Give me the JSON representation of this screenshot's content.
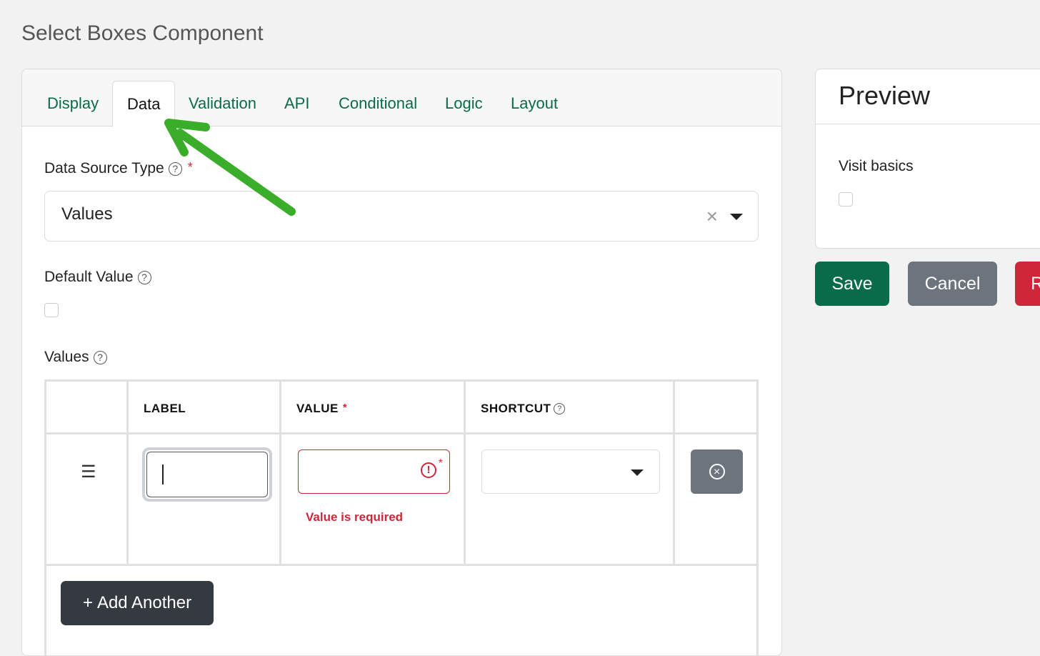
{
  "page": {
    "title": "Select Boxes Component"
  },
  "tabs": [
    {
      "label": "Display"
    },
    {
      "label": "Data"
    },
    {
      "label": "Validation"
    },
    {
      "label": "API"
    },
    {
      "label": "Conditional"
    },
    {
      "label": "Logic"
    },
    {
      "label": "Layout"
    }
  ],
  "active_tab": "Data",
  "data_source": {
    "label": "Data Source Type",
    "value": "Values",
    "clear_symbol": "×"
  },
  "default_value": {
    "label": "Default Value",
    "checked": false
  },
  "values_grid": {
    "label": "Values",
    "columns": {
      "label": "LABEL",
      "value": "VALUE",
      "shortcut": "SHORTCUT"
    },
    "row": {
      "label": "",
      "value": "",
      "shortcut": "",
      "error": "Value is required"
    },
    "drag_symbol": "☰",
    "add_label": "Add Another",
    "add_symbol": "+"
  },
  "preview": {
    "title": "Preview",
    "field_label": "Visit basics"
  },
  "actions": {
    "save": "Save",
    "cancel": "Cancel",
    "remove": "R"
  },
  "colors": {
    "accent": "#0a6b4a",
    "danger": "#d0263a",
    "secondary": "#6c757d",
    "dark": "#343a40",
    "annotation_arrow": "#3aae2a"
  }
}
